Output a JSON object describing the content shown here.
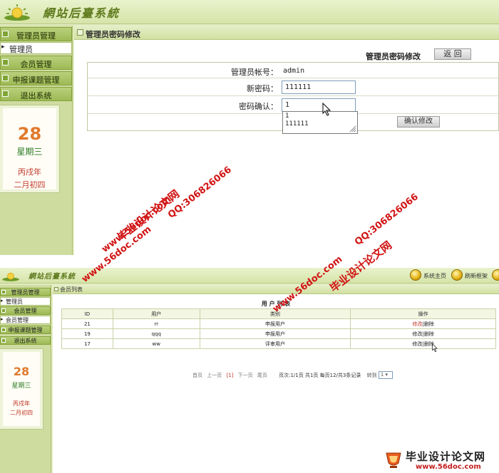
{
  "app": {
    "title": "網站后臺系統"
  },
  "sidebar": {
    "items": [
      {
        "label": "管理员管理",
        "type": "header"
      },
      {
        "label": "管理员",
        "type": "sub"
      },
      {
        "label": "会员管理",
        "type": "header"
      },
      {
        "label": "申报课题管理",
        "type": "header"
      },
      {
        "label": "退出系统",
        "type": "header"
      }
    ]
  },
  "calendar": {
    "day": "28",
    "weekday": "星期三",
    "year_cn": "丙戌年",
    "lunar": "二月初四"
  },
  "password_page": {
    "breadcrumb": "管理员密码修改",
    "title": "管理员密码修改",
    "back_label": "返 回",
    "account_label": "管理员帐号：",
    "account_value": "admin",
    "new_password_label": "新密码：",
    "new_password_value": "111111",
    "confirm_label": "密码确认：",
    "confirm_value": "1",
    "autocomplete_options": [
      "1",
      "111111"
    ],
    "confirm_button": "确认修改"
  },
  "user_page": {
    "sidebar": {
      "items": [
        {
          "label": "管理员管理",
          "type": "header"
        },
        {
          "label": "管理员",
          "type": "sub"
        },
        {
          "label": "会员管理",
          "type": "header"
        },
        {
          "label": "会员管理",
          "type": "sub"
        },
        {
          "label": "申报课题管理",
          "type": "header"
        },
        {
          "label": "退出系统",
          "type": "header"
        }
      ]
    },
    "toolbar": {
      "home_label": "系统主页",
      "refresh_label": "刷新框架"
    },
    "breadcrumb": "会员列表",
    "table_title": "用 户 列 表",
    "columns": [
      "ID",
      "用户",
      "类别",
      "操作"
    ],
    "rows": [
      {
        "id": "21",
        "user": "rr",
        "type": "申报用户",
        "edit": "修改",
        "delete": "删除"
      },
      {
        "id": "19",
        "user": "qqq",
        "type": "申报用户",
        "edit": "修改",
        "delete": "删除"
      },
      {
        "id": "17",
        "user": "ww",
        "type": "评审用户",
        "edit": "修改",
        "delete": "删除"
      }
    ],
    "pager": {
      "first": "首页",
      "prev": "上一页",
      "current": "[1]",
      "next": "下一页",
      "last": "尾页",
      "info": "页次:1/1页 共1页 每页12/共3条记录",
      "goto_label": "转到",
      "page_select": "1"
    }
  },
  "watermarks": {
    "site_cn": "毕业设计论文网",
    "site_url": "www.56doc.com",
    "qq": "QQ:306826066"
  },
  "footer_logo": {
    "cn": "毕业设计论文网",
    "url": "www.56doc.com"
  },
  "colors": {
    "frame_green": "#cfdca0",
    "menu_green": "#9dba55",
    "watermark_red": "#d11414",
    "calendar_day": "#e07a2d"
  }
}
